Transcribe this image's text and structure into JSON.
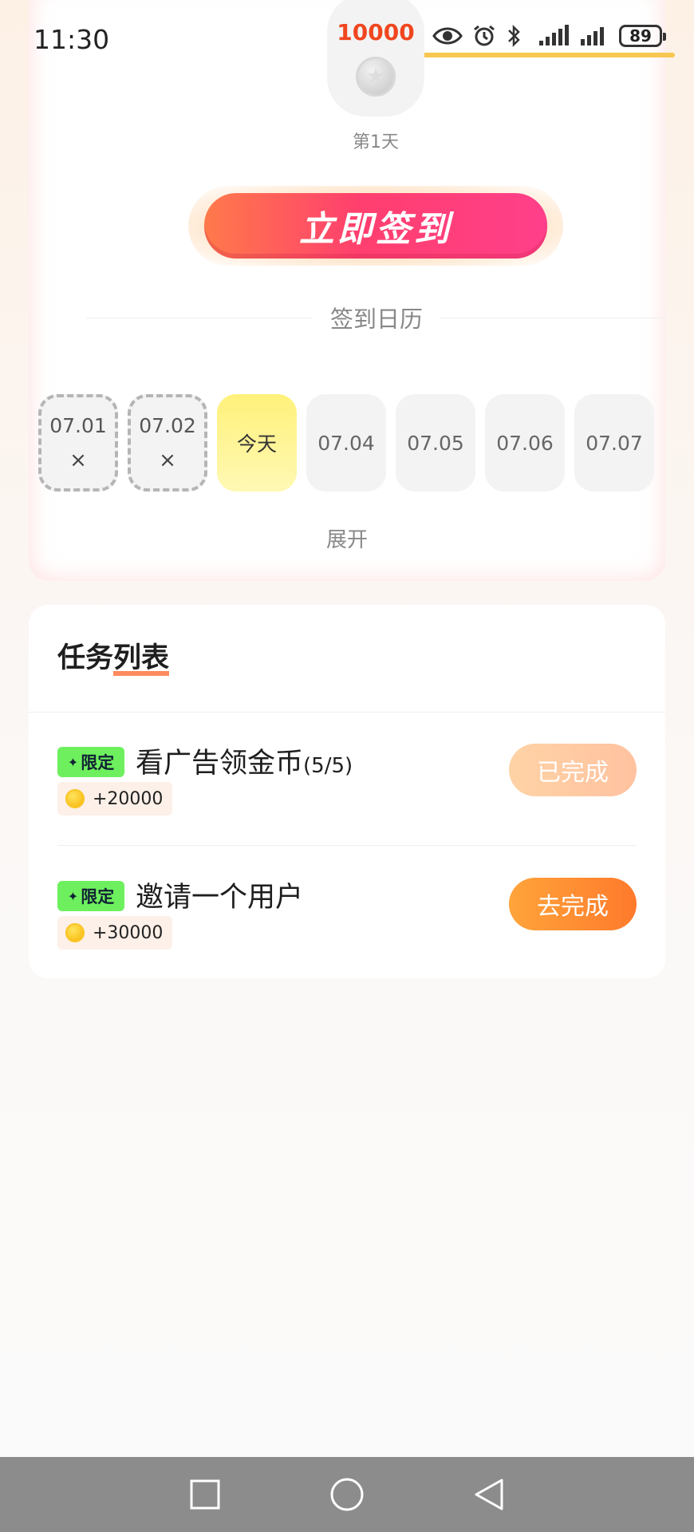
{
  "status_bar": {
    "time": "11:30",
    "battery": "89",
    "icons": [
      "eye-icon",
      "alarm-icon",
      "bluetooth-icon",
      "signal-icon",
      "signal-icon",
      "battery-icon"
    ]
  },
  "checkin": {
    "reward_amount": "10000",
    "day_label": "第1天",
    "sign_button": "立即签到",
    "calendar_title": "签到日历",
    "days": [
      {
        "label": "07.01",
        "mark": "×"
      },
      {
        "label": "07.02",
        "mark": "×"
      },
      {
        "label": "今天"
      },
      {
        "label": "07.04"
      },
      {
        "label": "07.05"
      },
      {
        "label": "07.06"
      },
      {
        "label": "07.07"
      }
    ],
    "expand": "展开"
  },
  "tasks": {
    "heading_a": "任务",
    "heading_b": "列表",
    "items": [
      {
        "badge": "限定",
        "title": "看广告领金币",
        "count": "(5/5)",
        "reward": "+20000",
        "button": "已完成"
      },
      {
        "badge": "限定",
        "title": "邀请一个用户",
        "count": "",
        "reward": "+30000",
        "button": "去完成"
      }
    ]
  },
  "colors": {
    "accent_red": "#f0461f",
    "sign_btn": "#ff3f6e",
    "today_bg": "#fff17a",
    "badge_green": "#6ef05e",
    "btn_orange": "#ff7a2c",
    "btn_done": "#ffc2a0"
  }
}
